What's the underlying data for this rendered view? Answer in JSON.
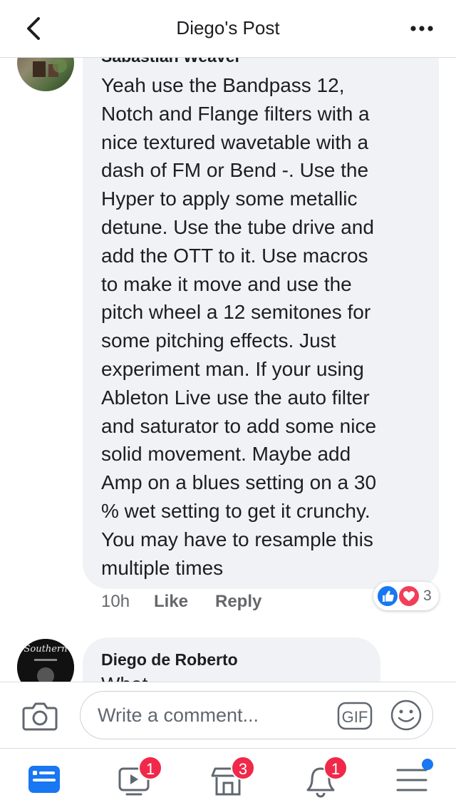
{
  "header": {
    "title": "Diego's Post",
    "back_icon": "chevron-left-icon",
    "more_icon": "more-horizontal-icon"
  },
  "comments": [
    {
      "author": "Sabastian Weaver",
      "text": "Yeah use the Bandpass 12,\nNotch and Flange filters with a\nnice textured wavetable with a\ndash of FM or Bend -. Use the\nHyper to apply some metallic\ndetune. Use the tube drive and\nadd the OTT to it. Use macros\nto make it move and use the\npitch wheel a 12 semitones for\nsome pitching effects. Just\nexperiment man. If your using\nAbleton Live use the auto filter\nand saturator to add some nice\nsolid movement. Maybe add\nAmp on a blues setting on a 30\n% wet setting to get it crunchy.\nYou may have to resample this\nmultiple times",
      "time": "10h",
      "like_label": "Like",
      "reply_label": "Reply",
      "reaction_count": "3"
    },
    {
      "author": "Diego de Roberto",
      "text": "What ...",
      "avatar_text": "Southern"
    }
  ],
  "composer": {
    "placeholder": "Write a comment...",
    "gif_label": "GIF"
  },
  "tabs": [
    {
      "name": "news-feed",
      "icon": "feed-icon",
      "badge": "",
      "active": true
    },
    {
      "name": "watch",
      "icon": "video-icon",
      "badge": "1"
    },
    {
      "name": "marketplace",
      "icon": "shop-icon",
      "badge": "3"
    },
    {
      "name": "notifications",
      "icon": "bell-icon",
      "badge": "1"
    },
    {
      "name": "menu",
      "icon": "menu-icon",
      "badge": ""
    }
  ],
  "colors": {
    "accent": "#1877f2",
    "badge": "#f02849",
    "bubble": "#f0f2f5"
  }
}
